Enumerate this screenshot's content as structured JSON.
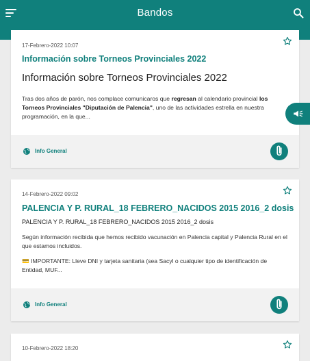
{
  "appbar": {
    "title": "Bandos"
  },
  "cards": [
    {
      "date": "17-Febrero-2022 10:07",
      "headline": "Información sobre Torneos Provinciales 2022",
      "subhead": "Información sobre Torneos Provinciales 2022",
      "body_1a": "Tras dos años de parón, nos complace comunicaros que ",
      "body_1b": "regresan",
      "body_1c": " al calendario provincial ",
      "body_1d": "los Torneos Provinciales \"Diputación de Palencia\"",
      "body_1e": ", uno de las actividades estrella en nuestra programación, en la que...",
      "category": "Info General"
    },
    {
      "date": "14-Febrero-2022 09:02",
      "headline": "PALENCIA Y P. RURAL_18 FEBRERO_NACIDOS 2015 2016_2 dosis",
      "subhead": "PALENCIA Y P. RURAL_18 FEBRERO_NACIDOS 2015 2016_2 dosis",
      "body_1": "Según información recibida que hemos recibido vacunación en Palencia capital y Palencia Rural en el que estamos incluidos.",
      "body_2": "💳 IMPORTANTE: Lleve DNI y tarjeta sanitaria (sea Sacyl o cualquier tipo de identificación de Entidad, MUF...",
      "category": "Info General"
    },
    {
      "date": "10-Febrero-2022 18:20"
    }
  ],
  "colors": {
    "brand": "#10807c",
    "background": "#ececec",
    "card_footer": "#f2f2f2"
  },
  "icons": {
    "menu": "menu-icon",
    "search": "search-icon",
    "star": "star-outline-icon",
    "globe": "globe-icon",
    "attachment": "paperclip-icon",
    "megaphone": "megaphone-icon"
  }
}
